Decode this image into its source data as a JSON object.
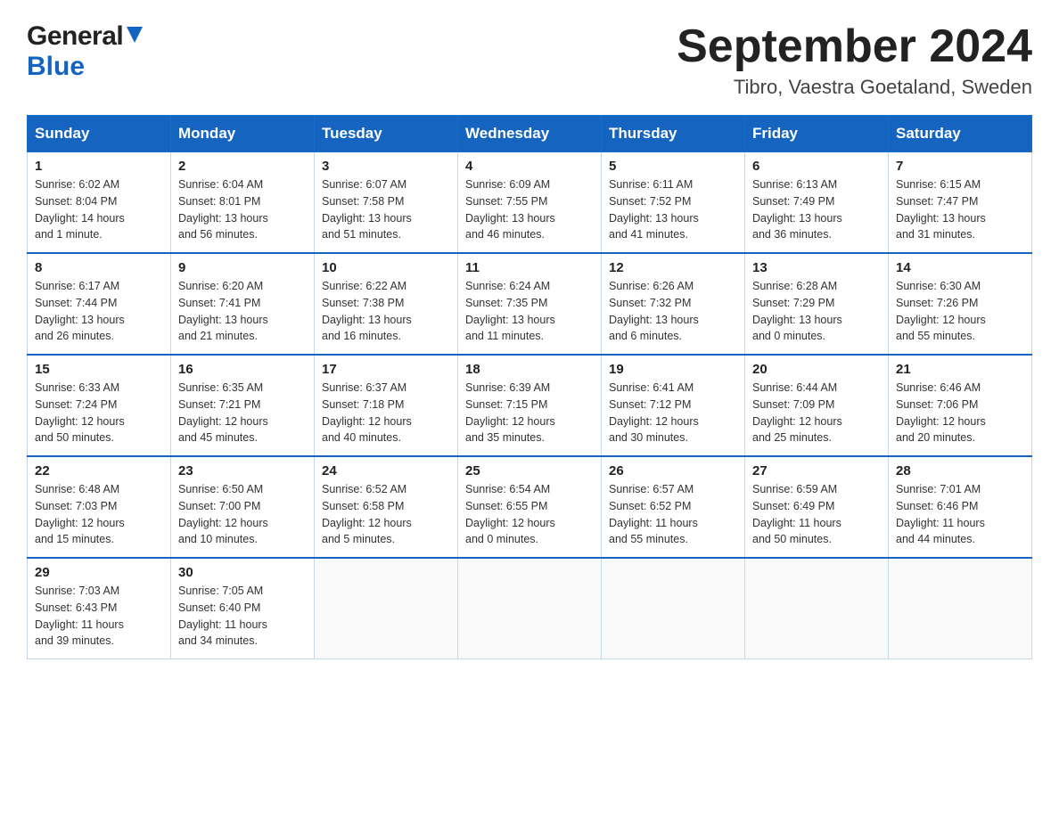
{
  "header": {
    "logo_general": "General",
    "logo_blue": "Blue",
    "month_title": "September 2024",
    "location": "Tibro, Vaestra Goetaland, Sweden"
  },
  "days_of_week": [
    "Sunday",
    "Monday",
    "Tuesday",
    "Wednesday",
    "Thursday",
    "Friday",
    "Saturday"
  ],
  "weeks": [
    [
      {
        "num": "1",
        "info": "Sunrise: 6:02 AM\nSunset: 8:04 PM\nDaylight: 14 hours\nand 1 minute."
      },
      {
        "num": "2",
        "info": "Sunrise: 6:04 AM\nSunset: 8:01 PM\nDaylight: 13 hours\nand 56 minutes."
      },
      {
        "num": "3",
        "info": "Sunrise: 6:07 AM\nSunset: 7:58 PM\nDaylight: 13 hours\nand 51 minutes."
      },
      {
        "num": "4",
        "info": "Sunrise: 6:09 AM\nSunset: 7:55 PM\nDaylight: 13 hours\nand 46 minutes."
      },
      {
        "num": "5",
        "info": "Sunrise: 6:11 AM\nSunset: 7:52 PM\nDaylight: 13 hours\nand 41 minutes."
      },
      {
        "num": "6",
        "info": "Sunrise: 6:13 AM\nSunset: 7:49 PM\nDaylight: 13 hours\nand 36 minutes."
      },
      {
        "num": "7",
        "info": "Sunrise: 6:15 AM\nSunset: 7:47 PM\nDaylight: 13 hours\nand 31 minutes."
      }
    ],
    [
      {
        "num": "8",
        "info": "Sunrise: 6:17 AM\nSunset: 7:44 PM\nDaylight: 13 hours\nand 26 minutes."
      },
      {
        "num": "9",
        "info": "Sunrise: 6:20 AM\nSunset: 7:41 PM\nDaylight: 13 hours\nand 21 minutes."
      },
      {
        "num": "10",
        "info": "Sunrise: 6:22 AM\nSunset: 7:38 PM\nDaylight: 13 hours\nand 16 minutes."
      },
      {
        "num": "11",
        "info": "Sunrise: 6:24 AM\nSunset: 7:35 PM\nDaylight: 13 hours\nand 11 minutes."
      },
      {
        "num": "12",
        "info": "Sunrise: 6:26 AM\nSunset: 7:32 PM\nDaylight: 13 hours\nand 6 minutes."
      },
      {
        "num": "13",
        "info": "Sunrise: 6:28 AM\nSunset: 7:29 PM\nDaylight: 13 hours\nand 0 minutes."
      },
      {
        "num": "14",
        "info": "Sunrise: 6:30 AM\nSunset: 7:26 PM\nDaylight: 12 hours\nand 55 minutes."
      }
    ],
    [
      {
        "num": "15",
        "info": "Sunrise: 6:33 AM\nSunset: 7:24 PM\nDaylight: 12 hours\nand 50 minutes."
      },
      {
        "num": "16",
        "info": "Sunrise: 6:35 AM\nSunset: 7:21 PM\nDaylight: 12 hours\nand 45 minutes."
      },
      {
        "num": "17",
        "info": "Sunrise: 6:37 AM\nSunset: 7:18 PM\nDaylight: 12 hours\nand 40 minutes."
      },
      {
        "num": "18",
        "info": "Sunrise: 6:39 AM\nSunset: 7:15 PM\nDaylight: 12 hours\nand 35 minutes."
      },
      {
        "num": "19",
        "info": "Sunrise: 6:41 AM\nSunset: 7:12 PM\nDaylight: 12 hours\nand 30 minutes."
      },
      {
        "num": "20",
        "info": "Sunrise: 6:44 AM\nSunset: 7:09 PM\nDaylight: 12 hours\nand 25 minutes."
      },
      {
        "num": "21",
        "info": "Sunrise: 6:46 AM\nSunset: 7:06 PM\nDaylight: 12 hours\nand 20 minutes."
      }
    ],
    [
      {
        "num": "22",
        "info": "Sunrise: 6:48 AM\nSunset: 7:03 PM\nDaylight: 12 hours\nand 15 minutes."
      },
      {
        "num": "23",
        "info": "Sunrise: 6:50 AM\nSunset: 7:00 PM\nDaylight: 12 hours\nand 10 minutes."
      },
      {
        "num": "24",
        "info": "Sunrise: 6:52 AM\nSunset: 6:58 PM\nDaylight: 12 hours\nand 5 minutes."
      },
      {
        "num": "25",
        "info": "Sunrise: 6:54 AM\nSunset: 6:55 PM\nDaylight: 12 hours\nand 0 minutes."
      },
      {
        "num": "26",
        "info": "Sunrise: 6:57 AM\nSunset: 6:52 PM\nDaylight: 11 hours\nand 55 minutes."
      },
      {
        "num": "27",
        "info": "Sunrise: 6:59 AM\nSunset: 6:49 PM\nDaylight: 11 hours\nand 50 minutes."
      },
      {
        "num": "28",
        "info": "Sunrise: 7:01 AM\nSunset: 6:46 PM\nDaylight: 11 hours\nand 44 minutes."
      }
    ],
    [
      {
        "num": "29",
        "info": "Sunrise: 7:03 AM\nSunset: 6:43 PM\nDaylight: 11 hours\nand 39 minutes."
      },
      {
        "num": "30",
        "info": "Sunrise: 7:05 AM\nSunset: 6:40 PM\nDaylight: 11 hours\nand 34 minutes."
      },
      {
        "num": "",
        "info": ""
      },
      {
        "num": "",
        "info": ""
      },
      {
        "num": "",
        "info": ""
      },
      {
        "num": "",
        "info": ""
      },
      {
        "num": "",
        "info": ""
      }
    ]
  ]
}
